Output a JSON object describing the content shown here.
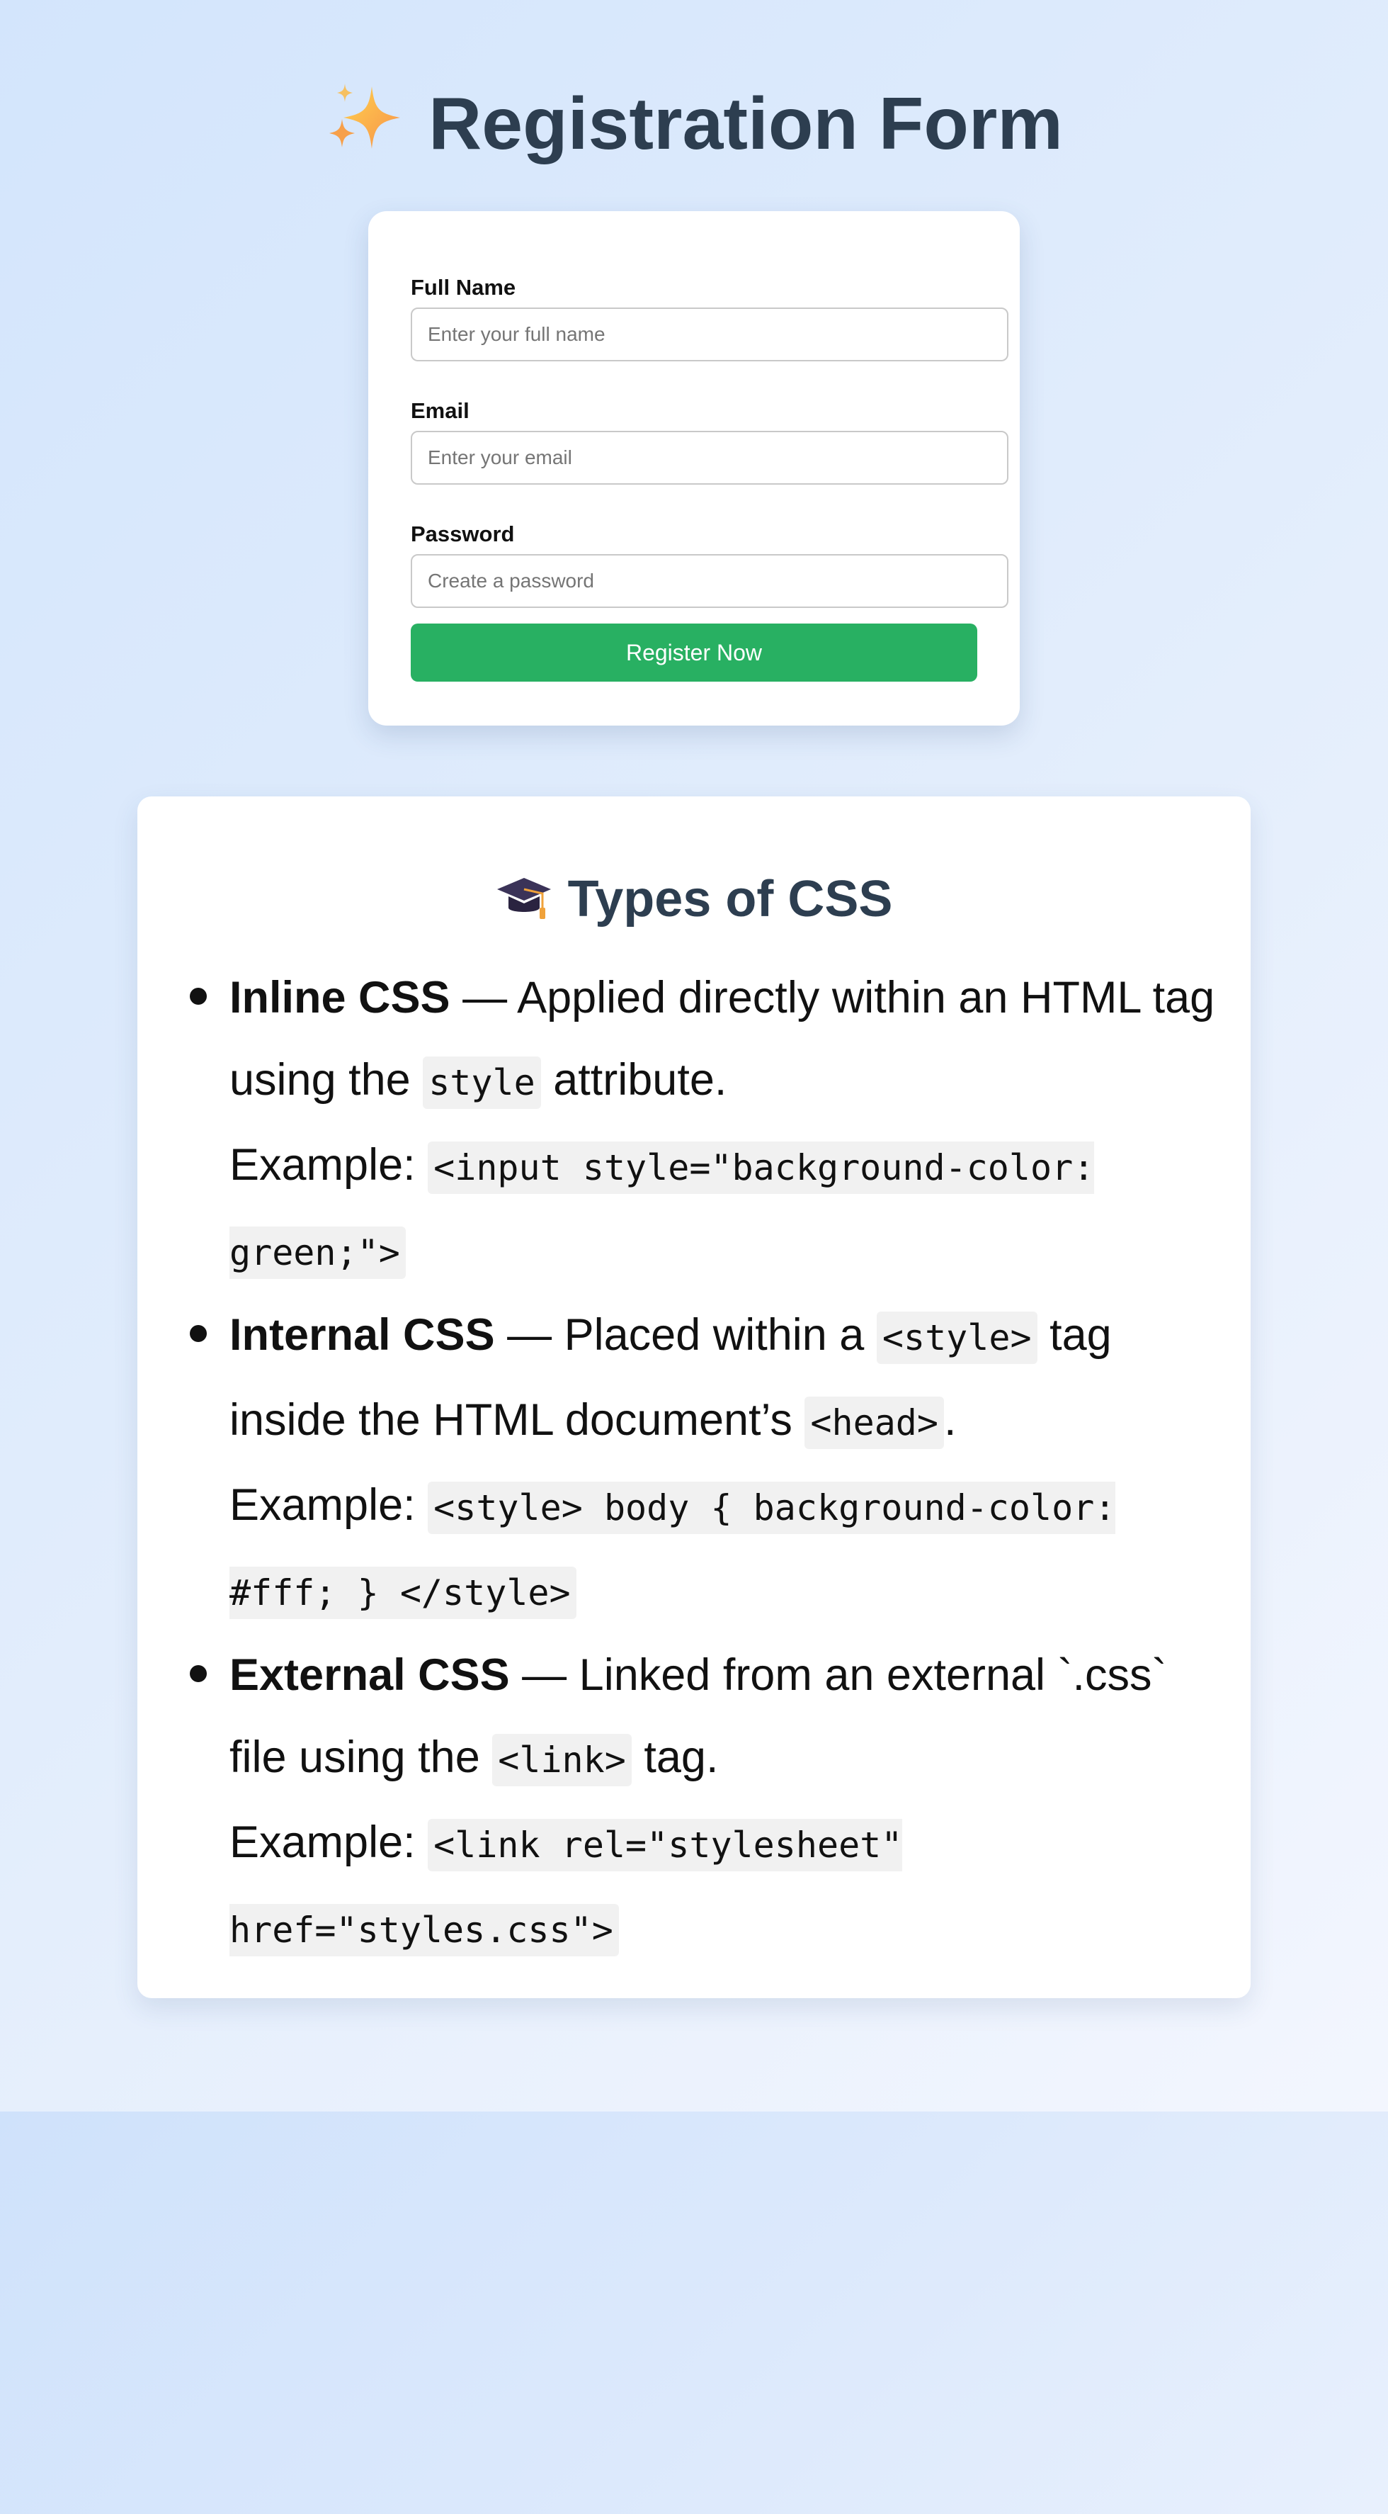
{
  "page": {
    "title": "Registration Form",
    "title_icon": "sparkles-icon"
  },
  "form": {
    "full_name": {
      "label": "Full Name",
      "placeholder": "Enter your full name",
      "value": ""
    },
    "email": {
      "label": "Email",
      "placeholder": "Enter your email",
      "value": ""
    },
    "password": {
      "label": "Password",
      "placeholder": "Create a password",
      "value": ""
    },
    "submit_label": "Register Now",
    "submit_color": "#28b062"
  },
  "css_types": {
    "title": "Types of CSS",
    "title_icon": "graduation-cap-icon",
    "items": [
      {
        "name": "Inline CSS",
        "desc_before": " — Applied directly within an HTML tag using the ",
        "code1": "style",
        "desc_after": " attribute.",
        "example_label": "Example: ",
        "example_code": "<input style=\"background-color: green;\">"
      },
      {
        "name": "Internal CSS",
        "desc_before": " — Placed within a ",
        "code1": "<style>",
        "desc_mid": " tag inside the HTML document’s ",
        "code2": "<head>",
        "desc_after": ".",
        "example_label": "Example: ",
        "example_code": "<style> body { background-color: #fff; } </style>"
      },
      {
        "name": "External CSS",
        "desc_before": " — Linked from an external `.css` file using the ",
        "code1": "<link>",
        "desc_after": " tag.",
        "example_label": "Example: ",
        "example_code": "<link rel=\"stylesheet\" href=\"styles.css\">"
      }
    ]
  },
  "colors": {
    "heading": "#2d3e50",
    "accent_green": "#28b062"
  }
}
